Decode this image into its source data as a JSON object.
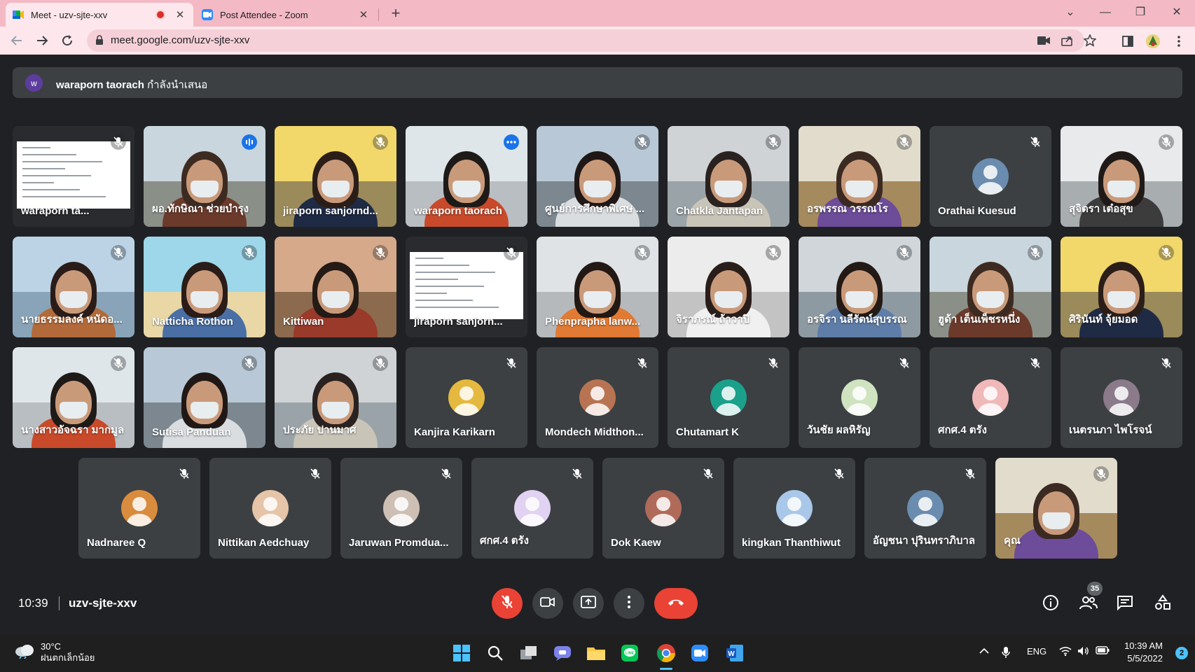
{
  "browser": {
    "tabs": [
      {
        "title": "Meet - uzv-sjte-xxv",
        "recording": true
      },
      {
        "title": "Post Attendee - Zoom"
      }
    ],
    "new_tab_label": "+",
    "url": "meet.google.com/uzv-sjte-xxv"
  },
  "presenting": {
    "initial": "w",
    "presenter": "waraporn taorach",
    "suffix": " กำลังนำเสนอ"
  },
  "tiles": [
    {
      "name": "waraporn ta...",
      "kind": "screen"
    },
    {
      "name": "ผอ.ทักษิณา ช่วยบำรุง",
      "kind": "video",
      "speaking": true
    },
    {
      "name": "jiraporn sanjornd...",
      "kind": "video"
    },
    {
      "name": "waraporn taorach",
      "kind": "video",
      "selected": true
    },
    {
      "name": "ศูนย์การศึกษาพิเศษ ...",
      "kind": "video"
    },
    {
      "name": "Chatkla Jantapan",
      "kind": "video"
    },
    {
      "name": "อรพรรณ วรรณโร",
      "kind": "video"
    },
    {
      "name": "Orathai Kuesud",
      "kind": "avatar"
    },
    {
      "name": "สุจิตรา เต๋อสุข",
      "kind": "video"
    },
    {
      "name": "นายธรรมลงค์ หนัดอ...",
      "kind": "video"
    },
    {
      "name": "Natticha Rothon",
      "kind": "video"
    },
    {
      "name": "Kittiwan",
      "kind": "video"
    },
    {
      "name": "jiraporn sanjorn...",
      "kind": "screen"
    },
    {
      "name": "Phenprapha lanw...",
      "kind": "video"
    },
    {
      "name": "จิราภรณ์ ถ้าวาปี",
      "kind": "video"
    },
    {
      "name": "อรจิรา นลีรัตน์สุบรรณ",
      "kind": "video"
    },
    {
      "name": "ฮูด้า เต็นเพ็ชรหนึ่ง",
      "kind": "video"
    },
    {
      "name": "ศิรินันท์ จุ้ยมอด",
      "kind": "video"
    },
    {
      "name": "นางสาวอัจฉรา มากมูล",
      "kind": "video"
    },
    {
      "name": "Sutisa Panduan",
      "kind": "video"
    },
    {
      "name": "ประภัย ปานมาศ",
      "kind": "video"
    },
    {
      "name": "Kanjira Karikarn",
      "kind": "avatar"
    },
    {
      "name": "Mondech Midthon...",
      "kind": "avatar"
    },
    {
      "name": "Chutamart K",
      "kind": "avatar"
    },
    {
      "name": "วันชัย ผลหิรัญ",
      "kind": "avatar"
    },
    {
      "name": "ศกศ.4 ตรัง",
      "kind": "avatar"
    },
    {
      "name": "เนตรนภา ไพโรจน์",
      "kind": "avatar"
    },
    {
      "name": "Nadnaree Q",
      "kind": "avatar"
    },
    {
      "name": "Nittikan Aedchuay",
      "kind": "avatar"
    },
    {
      "name": "Jaruwan Promdua...",
      "kind": "avatar"
    },
    {
      "name": "ศกศ.4 ตรัง",
      "kind": "avatar"
    },
    {
      "name": "Dok Kaew",
      "kind": "avatar"
    },
    {
      "name": "kingkan Thanthiwut",
      "kind": "avatar"
    },
    {
      "name": "อัญชนา ปุรินทราภิบาล",
      "kind": "avatar"
    },
    {
      "name": "คุณ",
      "kind": "video"
    }
  ],
  "meeting": {
    "time": "10:39",
    "code": "uzv-sjte-xxv",
    "participant_count": "35"
  },
  "taskbar": {
    "temperature": "30°C",
    "condition": "ฝนตกเล็กน้อย",
    "language": "ENG",
    "clock_time": "10:39 AM",
    "clock_date": "5/5/2022",
    "notifications": "2"
  },
  "colors": {
    "tab_strip": "#f3b9c4",
    "meet_bg": "#202124",
    "tile_bg": "#3c4043",
    "end_call_red": "#ea4335",
    "active_speaker_blue": "#8ab4f8"
  }
}
